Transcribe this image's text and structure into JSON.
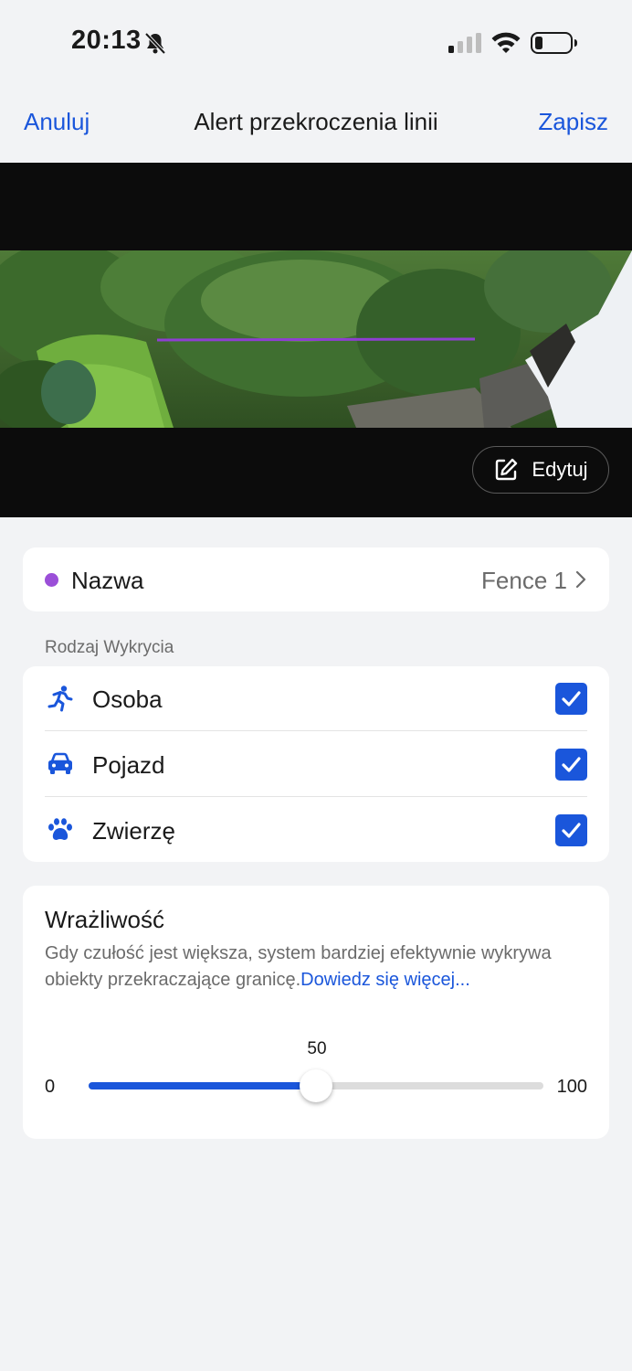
{
  "status_bar": {
    "time": "20:13",
    "icons": [
      "bell-slash-icon",
      "signal-icon",
      "wifi-icon",
      "battery-icon"
    ]
  },
  "nav": {
    "cancel_label": "Anuluj",
    "title": "Alert przekroczenia linii",
    "save_label": "Zapisz"
  },
  "camera": {
    "edit_label": "Edytuj",
    "line_color": "#8e3fd1"
  },
  "name_row": {
    "label": "Nazwa",
    "value": "Fence 1",
    "dot_color": "#9b4fd8"
  },
  "detection": {
    "section_label": "Rodzaj Wykrycia",
    "items": [
      {
        "label": "Osoba",
        "icon": "person-running-icon",
        "checked": true
      },
      {
        "label": "Pojazd",
        "icon": "car-icon",
        "checked": true
      },
      {
        "label": "Zwierzę",
        "icon": "paw-icon",
        "checked": true
      }
    ]
  },
  "sensitivity": {
    "title": "Wrażliwość",
    "description": "Gdy czułość jest większa, system bardziej efektywnie wykrywa obiekty przekraczające granicę.",
    "link_text": "Dowiedz się więcej...",
    "value": 50,
    "value_label": "50",
    "min_label": "0",
    "max_label": "100"
  },
  "colors": {
    "accent": "#1a56db",
    "background": "#f2f3f5"
  }
}
